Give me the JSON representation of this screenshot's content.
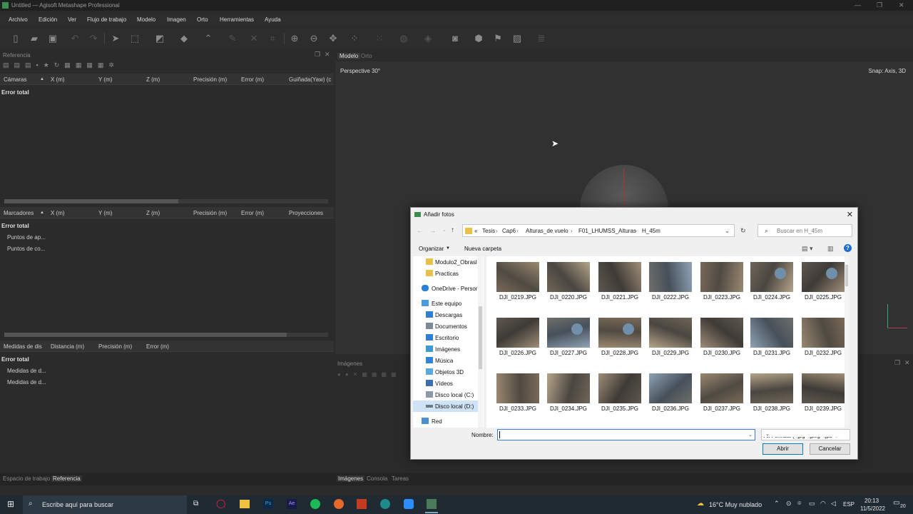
{
  "window": {
    "title": "Untitled — Agisoft Metashape Professional"
  },
  "menu": [
    "Archivo",
    "Edición",
    "Ver",
    "Flujo de trabajo",
    "Modelo",
    "Imagen",
    "Orto",
    "Herramientas",
    "Ayuda"
  ],
  "reference_panel": {
    "title": "Referencia",
    "cameras_table": {
      "headers": [
        "Cámaras",
        "X (m)",
        "Y (m)",
        "Z (m)",
        "Precisión (m)",
        "Error (m)",
        "Guiñada(Yaw) (c"
      ],
      "rows": [
        "Error total"
      ]
    },
    "markers_table": {
      "headers": [
        "Marcadores",
        "X (m)",
        "Y (m)",
        "Z (m)",
        "Precisión (m)",
        "Error (m)",
        "Proyecciones"
      ],
      "rows": [
        "Error total",
        "Puntos de ap...",
        "Puntos de co..."
      ]
    },
    "scale_table": {
      "headers": [
        "Medidas de dis",
        "Distancia (m)",
        "Precisión (m)",
        "Error (m)"
      ],
      "rows": [
        "Error total",
        "Medidas de d...",
        "Medidas de d..."
      ]
    }
  },
  "viewport": {
    "tabs": [
      "Modelo",
      "Orto"
    ],
    "projection_label": "Perspective 30°",
    "snap_label": "Snap: Axis, 3D"
  },
  "images_panel": {
    "title": "Imágenes"
  },
  "bottom_tabs_left": [
    "Espacio de trabajo",
    "Referencia"
  ],
  "bottom_tabs_right": [
    "Imágenes",
    "Consola",
    "Tareas"
  ],
  "dialog": {
    "title": "Añadir fotos",
    "breadcrumb": [
      "«",
      "Tesis",
      "Cap6",
      "Alturas_de vuelo",
      "F01_LHUMSS_Alturas",
      "H_45m"
    ],
    "search_placeholder": "Buscar en H_45m",
    "organize_label": "Organizar",
    "new_folder_label": "Nueva carpeta",
    "nav_items": [
      {
        "label": "Modulo2_Obrasl",
        "icon": "folder-icon"
      },
      {
        "label": "Practicas",
        "icon": "folder-icon"
      },
      {
        "label": "OneDrive - Persor",
        "icon": "cloud-icon"
      },
      {
        "label": "Este equipo",
        "icon": "computer-icon"
      },
      {
        "label": "Descargas",
        "icon": "download-icon"
      },
      {
        "label": "Documentos",
        "icon": "document-icon"
      },
      {
        "label": "Escritorio",
        "icon": "desktop-icon"
      },
      {
        "label": "Imágenes",
        "icon": "pictures-icon"
      },
      {
        "label": "Música",
        "icon": "music-icon"
      },
      {
        "label": "Objetos 3D",
        "icon": "cube-icon"
      },
      {
        "label": "Vídeos",
        "icon": "video-icon"
      },
      {
        "label": "Disco local (C:)",
        "icon": "drive-icon"
      },
      {
        "label": "Disco local (D:)",
        "icon": "drive-icon"
      },
      {
        "label": "Red",
        "icon": "network-icon"
      }
    ],
    "selected_nav": "Disco local (D:)",
    "files": [
      "DJI_0219.JPG",
      "DJI_0220.JPG",
      "DJI_0221.JPG",
      "DJI_0222.JPG",
      "DJI_0223.JPG",
      "DJI_0224.JPG",
      "DJI_0225.JPG",
      "DJI_0226.JPG",
      "DJI_0227.JPG",
      "DJI_0228.JPG",
      "DJI_0229.JPG",
      "DJI_0230.JPG",
      "DJI_0231.JPG",
      "DJI_0232.JPG",
      "DJI_0233.JPG",
      "DJI_0234.JPG",
      "DJI_0235.JPG",
      "DJI_0236.JPG",
      "DJI_0237.JPG",
      "DJI_0238.JPG",
      "DJI_0239.JPG"
    ],
    "filename_label": "Nombre:",
    "filename_value": "",
    "filter_value": "All Formats (*.jpg *.jpeg *.jp2 *.",
    "open_label": "Abrir",
    "cancel_label": "Cancelar"
  },
  "taskbar": {
    "search_placeholder": "Escribe aquí para buscar",
    "weather": "16°C  Muy nublado",
    "lang": "ESP",
    "time": "20:13",
    "date": "11/5/2022",
    "notif_count": "20"
  },
  "colors": {
    "accent": "#0078d7",
    "app_bg": "#2b2b2b",
    "dialog_bg": "#f0f0f0"
  }
}
